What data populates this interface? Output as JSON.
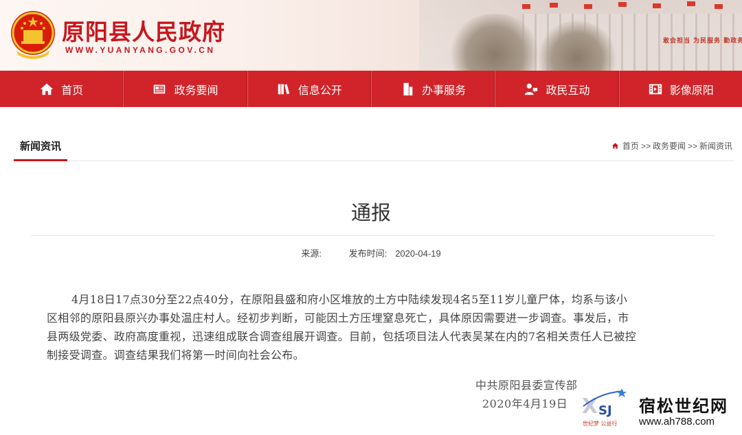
{
  "header": {
    "site_title": "原阳县人民政府",
    "site_url": "WWW.YUANYANG.GOV.CN",
    "banner_slogan": "敢会担当 为民服务 勤政务实 敢于担当 清正廉洁"
  },
  "nav": {
    "items": [
      {
        "label": "首页",
        "icon": "home-icon"
      },
      {
        "label": "政务要闻",
        "icon": "newspaper-icon"
      },
      {
        "label": "信息公开",
        "icon": "books-icon"
      },
      {
        "label": "办事服务",
        "icon": "building-icon"
      },
      {
        "label": "政民互动",
        "icon": "user-chat-icon"
      },
      {
        "label": "影像原阳",
        "icon": "film-icon"
      }
    ]
  },
  "section": {
    "tab_label": "新闻资讯",
    "breadcrumb": [
      {
        "label": "首页"
      },
      {
        "label": "政务要闻"
      },
      {
        "label": "新闻资讯"
      }
    ],
    "separator": ">>"
  },
  "article": {
    "title": "通报",
    "source_label": "来源:",
    "source_value": "",
    "date_label": "发布时间:",
    "date_value": "2020-04-19",
    "body": "4月18日17点30分至22点40分，在原阳县盛和府小区堆放的土方中陆续发现4名5至11岁儿童尸体，均系与该小区相邻的原阳县原兴办事处温庄村人。经初步判断，可能因土方压埋窒息死亡，具体原因需要进一步调查。事发后，市县两级党委、政府高度重视，迅速组成联合调查组展开调查。目前，包括项目法人代表吴某在内的7名相关责任人已被控制接受调查。调查结果我们将第一时间向社会公布。",
    "signature_org": "中共原阳县委宣传部",
    "signature_date": "2020年4月19日"
  },
  "watermark": {
    "name": "宿松世纪网",
    "url": "www.ah788.com",
    "logo_text": "XSJ",
    "sub_text": "世纪梦 公益行"
  },
  "colors": {
    "brand_red": "#c8161d",
    "nav_red": "#d0242a"
  }
}
